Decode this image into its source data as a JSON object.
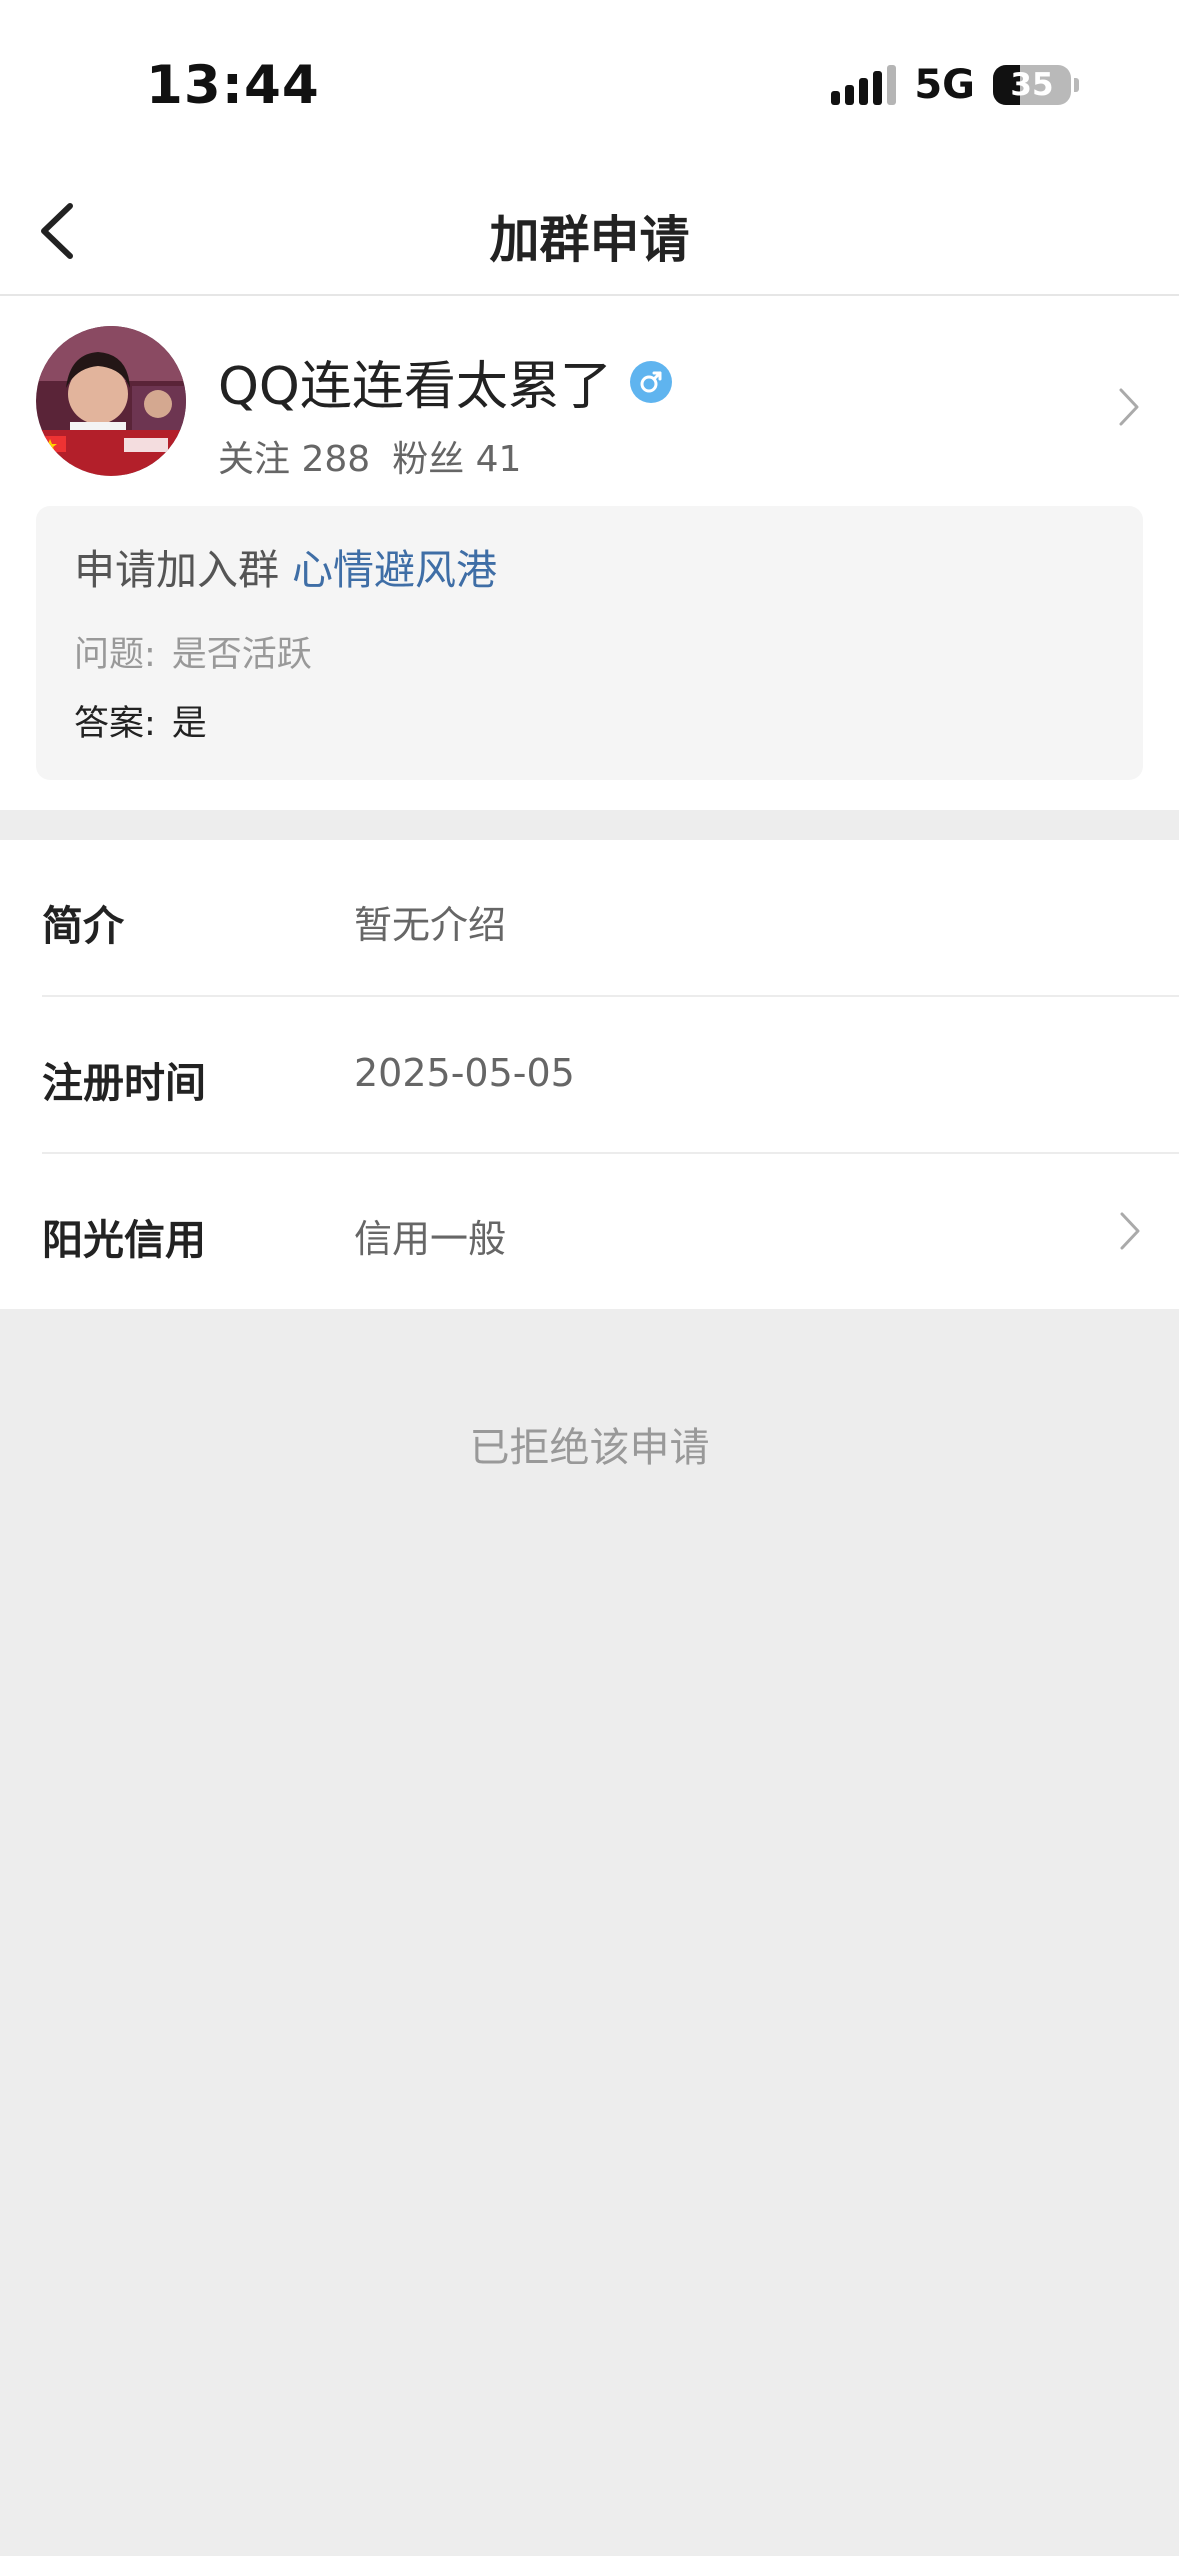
{
  "status_bar": {
    "time": "13:44",
    "network": "5G",
    "battery": "35",
    "battery_level": 0.35
  },
  "nav": {
    "title": "加群申请",
    "back_icon": "chevron-left-icon"
  },
  "profile": {
    "name": "QQ连连看太累了",
    "gender_icon": "male-icon",
    "following_label": "关注",
    "following_count": "288",
    "followers_label": "粉丝",
    "followers_count": "41"
  },
  "request": {
    "prefix": "申请加入群",
    "group_name": "心情避风港",
    "question_label": "问题:",
    "question": "是否活跃",
    "answer_label": "答案:",
    "answer": "是"
  },
  "info": [
    {
      "label": "简介",
      "value": "暂无介绍"
    },
    {
      "label": "注册时间",
      "value": "2025-05-05"
    },
    {
      "label": "阳光信用",
      "value": "信用一般"
    }
  ],
  "status_message": "已拒绝该申请",
  "colors": {
    "link_blue": "#3f6ea6",
    "gender_blue": "#5fb4ef",
    "background_gray": "#ededed"
  }
}
